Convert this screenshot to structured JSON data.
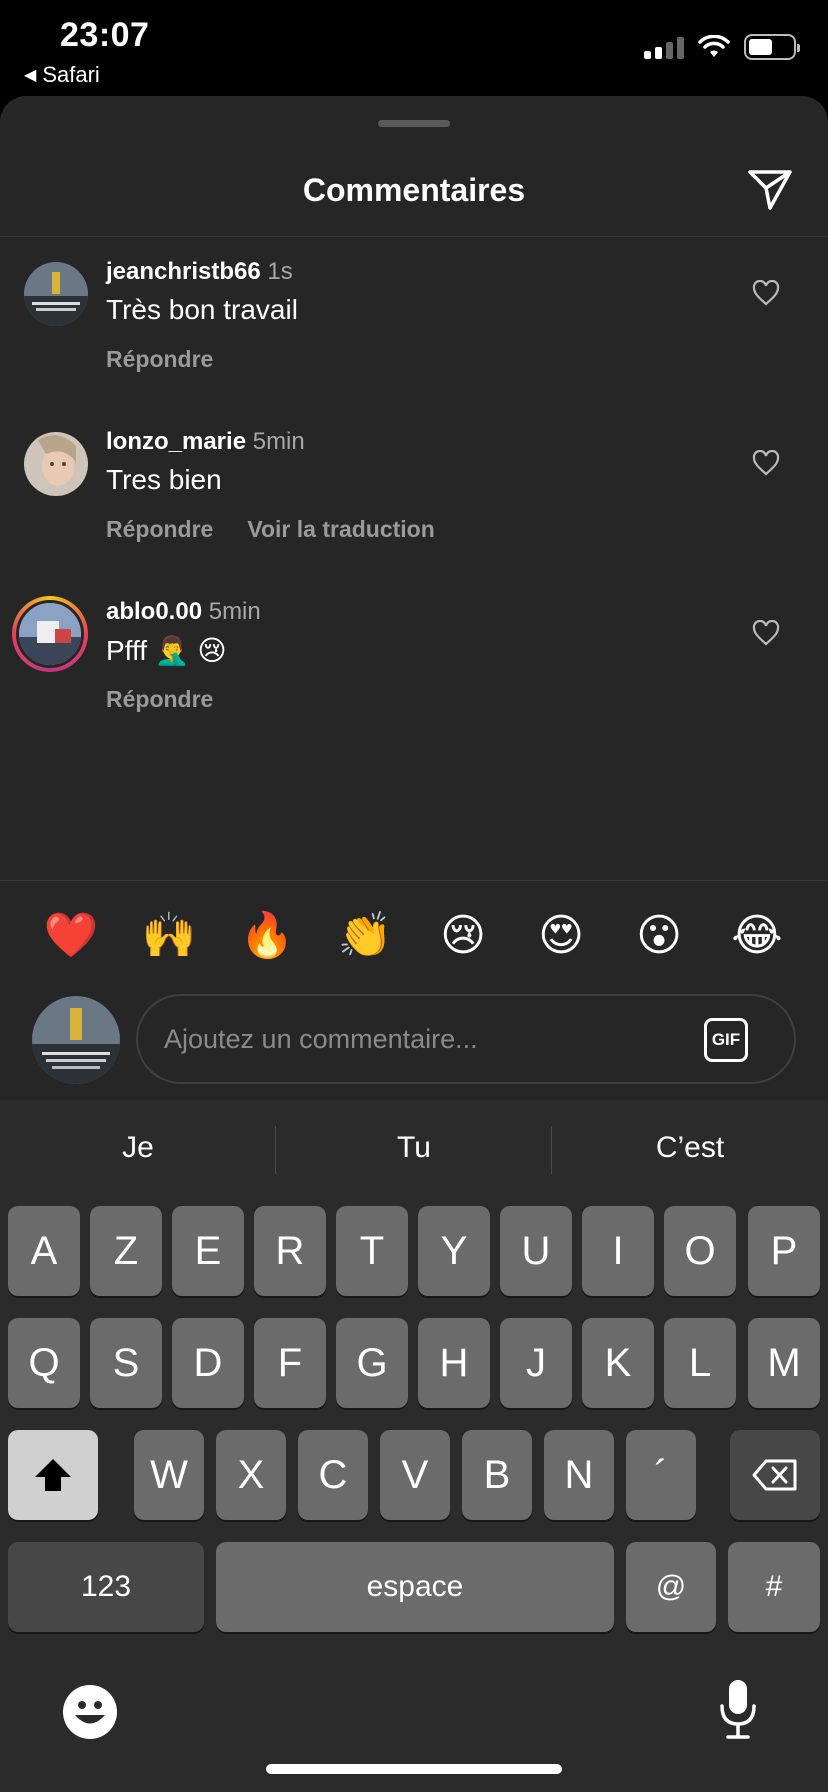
{
  "status_bar": {
    "time": "23:07",
    "back_app": "Safari",
    "back_icon": "back-triangle-icon"
  },
  "sheet": {
    "title": "Commentaires",
    "send_icon": "paper-plane-icon"
  },
  "comments": [
    {
      "user": "jeanchristb66",
      "time": "1s",
      "text": "Très bon travail",
      "actions": [
        "Répondre"
      ]
    },
    {
      "user": "lonzo_marie",
      "time": "5min",
      "text": "Tres bien",
      "actions": [
        "Répondre",
        "Voir la traduction"
      ]
    },
    {
      "user": "ablo0.00",
      "time": "5min",
      "text": "Pfff 🤦‍♂️ 😢",
      "actions": [
        "Répondre"
      ]
    }
  ],
  "emoji_bar": [
    "❤️",
    "🙌",
    "🔥",
    "👏",
    "😢",
    "😍",
    "😮",
    "😂"
  ],
  "composer": {
    "placeholder": "Ajoutez un commentaire...",
    "gif_label": "GIF"
  },
  "keyboard": {
    "suggestions": [
      "Je",
      "Tu",
      "C’est"
    ],
    "row1": [
      "A",
      "Z",
      "E",
      "R",
      "T",
      "Y",
      "U",
      "I",
      "O",
      "P"
    ],
    "row2": [
      "Q",
      "S",
      "D",
      "F",
      "G",
      "H",
      "J",
      "K",
      "L",
      "M"
    ],
    "row3": [
      "W",
      "X",
      "C",
      "V",
      "B",
      "N",
      "´"
    ],
    "numbers_label": "123",
    "space_label": "espace",
    "at_label": "@",
    "hash_label": "#"
  }
}
